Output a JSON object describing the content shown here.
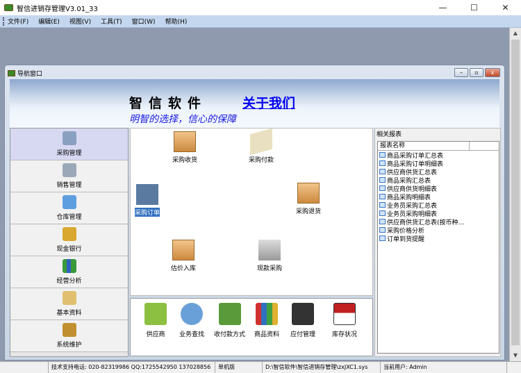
{
  "window": {
    "title": "智信进销存管理V3.01_33",
    "min": "—",
    "max": "☐",
    "close": "✕"
  },
  "menu": [
    "文件(F)",
    "编辑(E)",
    "视图(V)",
    "工具(T)",
    "窗口(W)",
    "帮助(H)"
  ],
  "child": {
    "title": "导航窗口",
    "min": "–",
    "restore": "▫",
    "close": "x"
  },
  "banner": {
    "brand": "智信软件",
    "about": "关于我们",
    "slogan": "明智的选择，信心的保障"
  },
  "nav": [
    "采购管理",
    "销售管理",
    "仓库管理",
    "现金银行",
    "经营分析",
    "基本资料",
    "系统维护"
  ],
  "functions": {
    "receive": "采购收货",
    "pay": "采购付款",
    "order": "采购订单",
    "return": "采购退货",
    "estimate": "估价入库",
    "cash": "现款采购"
  },
  "toolbar": [
    "供应商",
    "业务查找",
    "收付款方式",
    "商品资料",
    "应付管理",
    "库存状况"
  ],
  "reports": {
    "heading": "相关报表",
    "column": "报表名称",
    "items": [
      "商品采购订单汇总表",
      "商品采购订单明细表",
      "供应商供货汇总表",
      "商品采购汇总表",
      "供应商供货明细表",
      "商品采购明细表",
      "业务员采购汇总表",
      "业务员采购明细表",
      "供应商供货汇总表(按币种...",
      "采购价格分析",
      "订单到货提醒"
    ]
  },
  "status": {
    "support": "技术支持电话: 020-82319986 QQ:1725542950 137028856",
    "edition": "单机版",
    "path": "D:\\智信软件\\智信进销存管理\\zxJXC1.sys",
    "user": "当前用户: Admin"
  },
  "colors": {
    "menubar": "#c4d7ef",
    "mdi": "#8f9aae",
    "link": "#0000ee",
    "slogan": "#1a1ae0"
  }
}
